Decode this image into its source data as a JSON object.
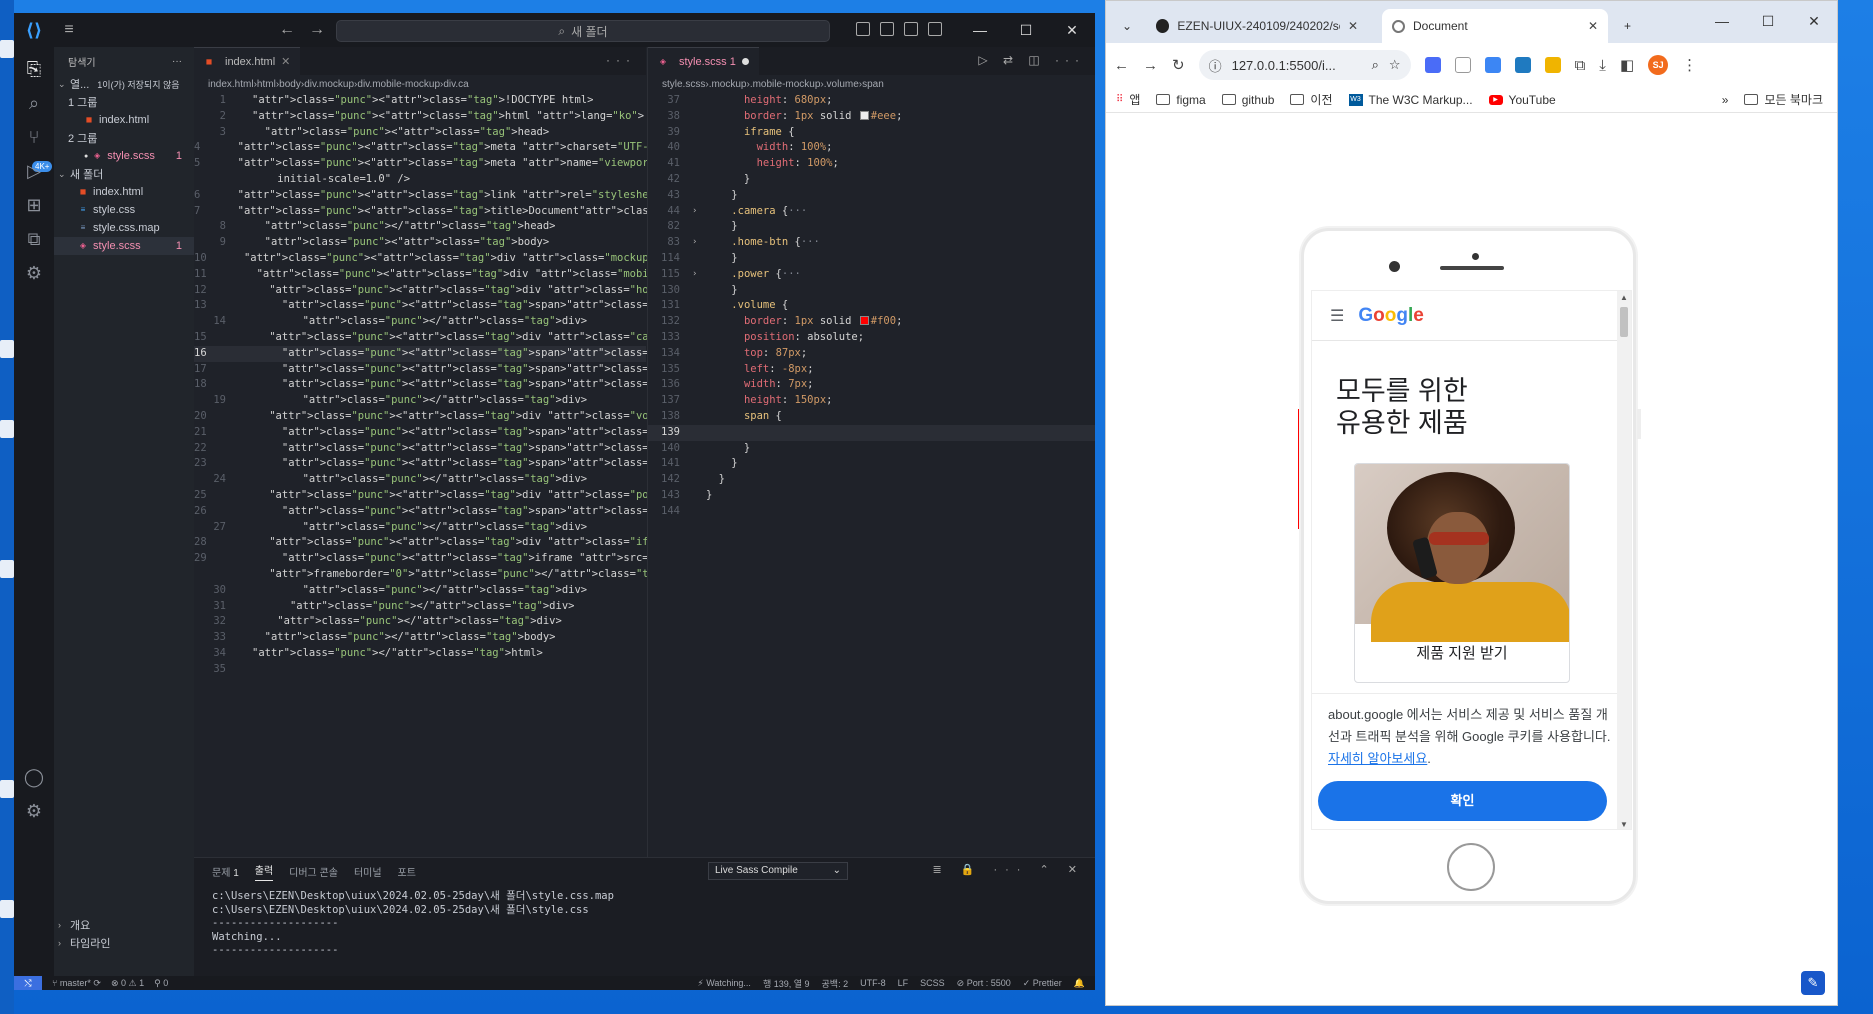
{
  "vscode": {
    "search_label": "새 폴더",
    "explorer_title": "탐색기",
    "open_editors_label": "열...",
    "unsaved_label": "1이(가) 저장되지 않음",
    "tree": [
      {
        "label": "1 그룹",
        "type": "group"
      },
      {
        "label": "index.html",
        "type": "html",
        "indent": 2
      },
      {
        "label": "2 그룹",
        "type": "group"
      },
      {
        "label": "style.scss",
        "type": "scss",
        "indent": 2,
        "badge": "1",
        "modified": true
      },
      {
        "label": "새 폴더",
        "type": "folder"
      },
      {
        "label": "index.html",
        "type": "html",
        "indent": 1
      },
      {
        "label": "style.css",
        "type": "css",
        "indent": 1
      },
      {
        "label": "style.css.map",
        "type": "map",
        "indent": 1
      },
      {
        "label": "style.scss",
        "type": "scss",
        "indent": 1,
        "badge": "1",
        "active": true
      }
    ],
    "outline_label": "개요",
    "timeline_label": "타임라인",
    "badge_count": "4K+",
    "left_tab": "index.html",
    "left_breadcrumb": [
      "index.html",
      "html",
      "body",
      "div.mockup",
      "div.mobile-mockup",
      "div.ca"
    ],
    "right_tab": "style.scss 1",
    "right_breadcrumb": [
      "style.scss",
      ".mockup",
      ".mobile-mockup",
      ".volume",
      "span"
    ],
    "html_lines": [
      {
        "n": "1",
        "code": "<!DOCTYPE html>"
      },
      {
        "n": "2",
        "code": "<html lang=\"ko\">"
      },
      {
        "n": "3",
        "code": "  <head>"
      },
      {
        "n": "4",
        "code": "    <meta charset=\"UTF-8\" />"
      },
      {
        "n": "5",
        "code": "    <meta name=\"viewport\" content=\"width=device-width,"
      },
      {
        "n": "",
        "code": "    initial-scale=1.0\" />"
      },
      {
        "n": "6",
        "code": "    <link rel=\"stylesheet\" href=\"./style.css\" />"
      },
      {
        "n": "7",
        "code": "    <title>Document</title>"
      },
      {
        "n": "8",
        "code": "  </head>"
      },
      {
        "n": "9",
        "code": "  <body>"
      },
      {
        "n": "10",
        "code": "    <div class=\"mockup\">"
      },
      {
        "n": "11",
        "code": "      <div class=\"mobile-mockup\">"
      },
      {
        "n": "12",
        "code": "        <div class=\"home-btn\">"
      },
      {
        "n": "13",
        "code": "          <span></span>"
      },
      {
        "n": "14",
        "code": "        </div>"
      },
      {
        "n": "15",
        "code": "        <div class=\"camera\">"
      },
      {
        "n": "16",
        "code": "          <span></span>",
        "current": true
      },
      {
        "n": "17",
        "code": "          <span></span>"
      },
      {
        "n": "18",
        "code": "          <span></span>"
      },
      {
        "n": "19",
        "code": "        </div>"
      },
      {
        "n": "20",
        "code": "        <div class=\"volume\">"
      },
      {
        "n": "21",
        "code": "          <span></span>"
      },
      {
        "n": "22",
        "code": "          <span></span>"
      },
      {
        "n": "23",
        "code": "          <span></span>"
      },
      {
        "n": "24",
        "code": "        </div>"
      },
      {
        "n": "25",
        "code": "        <div class=\"power\">"
      },
      {
        "n": "26",
        "code": "          <span></span>"
      },
      {
        "n": "27",
        "code": "        </div>"
      },
      {
        "n": "28",
        "code": "        <div class=\"iframe-url\">"
      },
      {
        "n": "29",
        "code": "          <iframe src=\"https://m.google.com\""
      },
      {
        "n": "",
        "code": "          frameborder=\"0\"></iframe>"
      },
      {
        "n": "30",
        "code": "        </div>"
      },
      {
        "n": "31",
        "code": "      </div>"
      },
      {
        "n": "32",
        "code": "    </div>"
      },
      {
        "n": "33",
        "code": "  </body>"
      },
      {
        "n": "34",
        "code": "</html>"
      },
      {
        "n": "35",
        "code": ""
      }
    ],
    "scss_lines": [
      {
        "n": "37",
        "code": "      height: 680px;"
      },
      {
        "n": "38",
        "code": "      border: 1px solid ■#eee;"
      },
      {
        "n": "39",
        "code": "      iframe {"
      },
      {
        "n": "40",
        "code": "        width: 100%;"
      },
      {
        "n": "41",
        "code": "        height: 100%;"
      },
      {
        "n": "42",
        "code": "      }"
      },
      {
        "n": "43",
        "code": "    }"
      },
      {
        "n": "44",
        "code": "    .camera {···",
        "fold": true
      },
      {
        "n": "82",
        "code": "    }"
      },
      {
        "n": "83",
        "code": "    .home-btn {···",
        "fold": true
      },
      {
        "n": "114",
        "code": "    }"
      },
      {
        "n": "115",
        "code": "    .power {···",
        "fold": true
      },
      {
        "n": "130",
        "code": "    }"
      },
      {
        "n": "131",
        "code": "    .volume {"
      },
      {
        "n": "132",
        "code": "      border: 1px solid ■#f00;"
      },
      {
        "n": "133",
        "code": "      position: absolute;"
      },
      {
        "n": "134",
        "code": "      top: 87px;"
      },
      {
        "n": "135",
        "code": "      left: -8px;"
      },
      {
        "n": "136",
        "code": "      width: 7px;"
      },
      {
        "n": "137",
        "code": "      height: 150px;"
      },
      {
        "n": "138",
        "code": "      span {"
      },
      {
        "n": "139",
        "code": "",
        "current": true
      },
      {
        "n": "140",
        "code": "      }"
      },
      {
        "n": "141",
        "code": "    }"
      },
      {
        "n": "142",
        "code": "  }"
      },
      {
        "n": "143",
        "code": "}"
      },
      {
        "n": "144",
        "code": ""
      }
    ],
    "panel": {
      "tabs": [
        "문제",
        "출력",
        "디버그 콘솔",
        "터미널",
        "포트"
      ],
      "problems_count": "1",
      "dropdown": "Live Sass Compile",
      "output_lines": [
        "c:\\Users\\EZEN\\Desktop\\uiux\\2024.02.05-25day\\새 폴더\\style.css.map",
        "c:\\Users\\EZEN\\Desktop\\uiux\\2024.02.05-25day\\새 폴더\\style.css",
        "--------------------",
        "Watching...",
        "--------------------"
      ]
    },
    "status": {
      "branch": "master*",
      "errors": "0",
      "warnings": "1",
      "ports_count": "0",
      "watching": "Watching...",
      "cursor": "행 139, 열 9",
      "spaces": "공백: 2",
      "encoding": "UTF-8",
      "eol": "LF",
      "language": "SCSS",
      "port": "Port : 5500",
      "formatter": "Prettier"
    }
  },
  "chrome": {
    "tab1": "EZEN-UIUX-240109/240202/sc",
    "tab2": "Document",
    "url": "127.0.0.1:5500/i...",
    "profile": "SJ",
    "bookmarks": [
      "앱",
      "figma",
      "github",
      "이전",
      "The W3C Markup...",
      "YouTube"
    ],
    "all_bookmarks": "모든 북마크",
    "page": {
      "logo_parts": [
        {
          "ch": "G",
          "color": "#4285f4"
        },
        {
          "ch": "o",
          "color": "#ea4335"
        },
        {
          "ch": "o",
          "color": "#fbbc05"
        },
        {
          "ch": "g",
          "color": "#4285f4"
        },
        {
          "ch": "l",
          "color": "#34a853"
        },
        {
          "ch": "e",
          "color": "#ea4335"
        }
      ],
      "headline_1": "모두를 위한",
      "headline_2": "유용한 제품",
      "card_label": "제품 지원 받기",
      "cookie_text_1": "about.google 에서는 서비스 제공 및 서비스 품질 개선과 트래픽 분석을 위해 Google 쿠키를 사용합니다. ",
      "cookie_link": "자세히 알아보세요",
      "cookie_end": ".",
      "confirm_button": "확인"
    }
  }
}
